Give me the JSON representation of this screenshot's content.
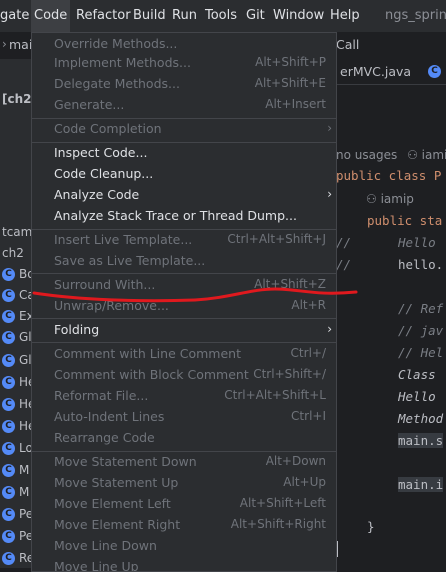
{
  "menubar": {
    "items": [
      {
        "label": "gate"
      },
      {
        "label": "Code"
      },
      {
        "label": "Refactor"
      },
      {
        "label": "Build"
      },
      {
        "label": "Run"
      },
      {
        "label": "Tools"
      },
      {
        "label": "Git"
      },
      {
        "label": "Window"
      },
      {
        "label": "Help"
      }
    ],
    "project": "ngs_spring_"
  },
  "tabs": {
    "left_tab": "mai",
    "center_tab_fragment": "Call",
    "right_tab": "erMVC.java"
  },
  "project_panel": {
    "header": "[ch2",
    "root_partial": "tcamp",
    "folder": "ch2",
    "items": [
      "Bo",
      "Ca",
      "Ex",
      "Gl",
      "Gl",
      "He",
      "He",
      "He",
      "Lo",
      "M",
      "M",
      "Pe",
      "Pe",
      "Re"
    ]
  },
  "editor": {
    "usages": "no usages",
    "author": "iamip",
    "author2": "iamip",
    "line_public_class": "public class P",
    "line_public_static": "public sta",
    "lines": [
      "Hello",
      "hello.",
      "// Ref",
      "// jav",
      "// Hel",
      "Class",
      "Hello",
      "Method",
      "main.s",
      "main.i",
      "}"
    ]
  },
  "menu": {
    "items": [
      {
        "label": "Override Methods...",
        "shortcut": "",
        "enabled": false
      },
      {
        "label": "Implement Methods...",
        "shortcut": "Alt+Shift+P",
        "enabled": false
      },
      {
        "label": "Delegate Methods...",
        "shortcut": "Alt+Shift+E",
        "enabled": false
      },
      {
        "label": "Generate...",
        "shortcut": "Alt+Insert",
        "enabled": false
      },
      {
        "label": "Code Completion",
        "shortcut": "",
        "enabled": false,
        "submenu": true
      },
      {
        "label": "Inspect Code...",
        "shortcut": "",
        "enabled": true
      },
      {
        "label": "Code Cleanup...",
        "shortcut": "",
        "enabled": true
      },
      {
        "label": "Analyze Code",
        "shortcut": "",
        "enabled": true,
        "submenu": true
      },
      {
        "label": "Analyze Stack Trace or Thread Dump...",
        "shortcut": "",
        "enabled": true
      },
      {
        "label": "Insert Live Template...",
        "shortcut": "Ctrl+Alt+Shift+J",
        "enabled": false
      },
      {
        "label": "Save as Live Template...",
        "shortcut": "",
        "enabled": false
      },
      {
        "label": "Surround With...",
        "shortcut": "Alt+Shift+Z",
        "enabled": false
      },
      {
        "label": "Unwrap/Remove...",
        "shortcut": "Alt+R",
        "enabled": false
      },
      {
        "label": "Folding",
        "shortcut": "",
        "enabled": true,
        "submenu": true
      },
      {
        "label": "Comment with Line Comment",
        "shortcut": "Ctrl+/",
        "enabled": false
      },
      {
        "label": "Comment with Block Comment",
        "shortcut": "Ctrl+Shift+/",
        "enabled": false
      },
      {
        "label": "Reformat File...",
        "shortcut": "Ctrl+Alt+Shift+L",
        "enabled": false
      },
      {
        "label": "Auto-Indent Lines",
        "shortcut": "Ctrl+I",
        "enabled": false
      },
      {
        "label": "Rearrange Code",
        "shortcut": "",
        "enabled": false
      },
      {
        "label": "Move Statement Down",
        "shortcut": "Alt+Down",
        "enabled": false
      },
      {
        "label": "Move Statement Up",
        "shortcut": "Alt+Up",
        "enabled": false
      },
      {
        "label": "Move Element Left",
        "shortcut": "Alt+Shift+Left",
        "enabled": false
      },
      {
        "label": "Move Element Right",
        "shortcut": "Alt+Shift+Right",
        "enabled": false
      },
      {
        "label": "Move Line Down",
        "shortcut": "",
        "enabled": false
      },
      {
        "label": "Move Line Up",
        "shortcut": "",
        "enabled": false
      }
    ]
  },
  "colors": {
    "menubar_bg": "#2b2d30",
    "menu_bg": "#2b2d30",
    "editor_bg": "#1e1f22",
    "keyword": "#cf8e6d",
    "annotation_underline": "#e0191e",
    "icon_blue": "#548af7"
  }
}
